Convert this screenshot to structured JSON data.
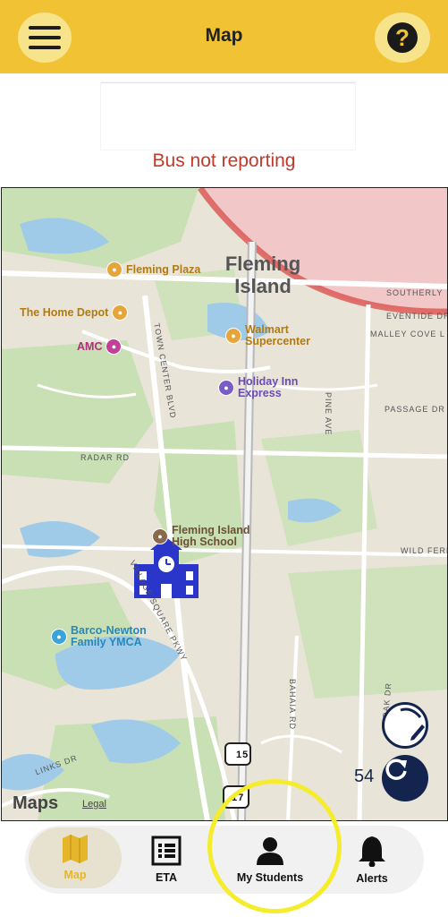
{
  "header": {
    "title": "Map",
    "menu_icon": "menu-icon",
    "help_icon": "help-icon",
    "accent": "#f1c233"
  },
  "status": {
    "message": "Bus not reporting",
    "color": "#c0392b"
  },
  "map": {
    "area_label": "Fleming Island",
    "pois": [
      {
        "name": "Fleming Plaza",
        "color": "#e5a53a"
      },
      {
        "name": "The Home Depot",
        "color": "#e5a53a"
      },
      {
        "name": "AMC",
        "color": "#c2409a"
      },
      {
        "name": "Walmart Supercenter",
        "color": "#e5a53a"
      },
      {
        "name": "Holiday Inn Express",
        "color": "#7a5cc7"
      },
      {
        "name": "Fleming Island High School",
        "color": "#8a6a4a"
      },
      {
        "name": "Barco-Newton Family YMCA",
        "color": "#3aa3d9"
      }
    ],
    "roads": {
      "southerly": "SOUTHERLY",
      "eventide": "EVENTIDE DR",
      "malley": "MALLEY COVE L",
      "passage": "PASSAGE DR",
      "pine_ave": "PINE AVE",
      "radar": "RADAR RD",
      "wild_fern": "WILD FERN",
      "town_center": "TOWN CENTER BLVD",
      "village_square": "VILLAGE SQUARE PKWY",
      "bahaia": "BAHAIA RD",
      "oak": "OAK DR",
      "links": "LINKS DR",
      "route": "15",
      "route2": "17"
    },
    "speed": "54",
    "maps_logo": "Maps",
    "legal": "Legal"
  },
  "tabs": [
    {
      "label": "Map",
      "icon": "map-icon"
    },
    {
      "label": "ETA",
      "icon": "eta-list-icon"
    },
    {
      "label": "My Students",
      "icon": "student-icon"
    },
    {
      "label": "Alerts",
      "icon": "bell-icon"
    }
  ]
}
